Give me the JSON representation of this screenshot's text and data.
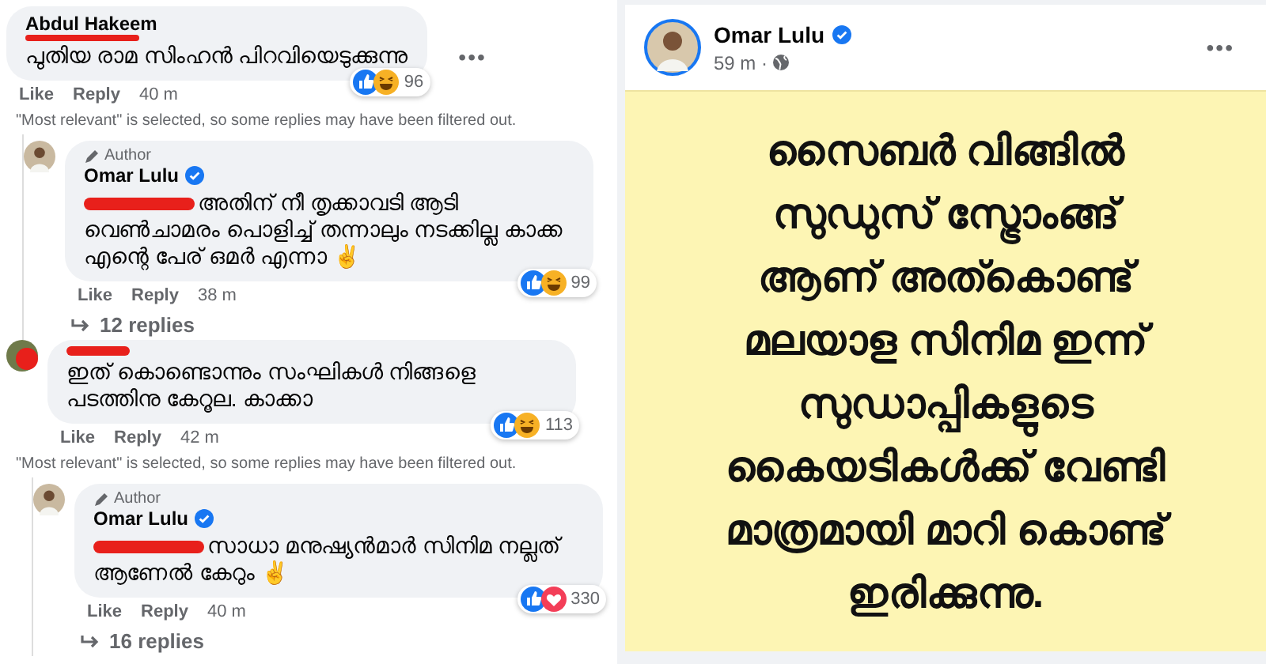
{
  "comments": [
    {
      "author": "Abdul Hakeem",
      "name_redacted": true,
      "text": "പുതിയ രാമ സിംഹൻ പിറവിയെടുക്കുന്നു",
      "reactions": [
        {
          "kind": "like"
        },
        {
          "kind": "haha"
        }
      ],
      "reaction_count": "96",
      "actions": [
        "Like",
        "Reply"
      ],
      "time": "40 m",
      "menu": "•••",
      "notice": "\"Most relevant\" is selected, so some replies may have been filtered out.",
      "replies": [
        {
          "badge": "Author",
          "author": "Omar Lulu",
          "verified": true,
          "mention_redacted": true,
          "text": "അതിന് നീ തൃക്കാവടി ആടി വെൺചാമരം പൊളിച്ച് തന്നാലും നടക്കില്ല കാക്ക എന്റെ പേര് ഒമർ എന്നാ ✌",
          "reactions": [
            {
              "kind": "like"
            },
            {
              "kind": "haha"
            }
          ],
          "reaction_count": "99",
          "actions": [
            "Like",
            "Reply"
          ],
          "time": "38 m",
          "more_replies": "12 replies"
        }
      ]
    },
    {
      "name_redacted": true,
      "text": "ഇത് കൊണ്ടൊന്നും സംഘികൾ നിങ്ങളെ പടത്തിനു കേറൂല. കാക്കാ",
      "reactions": [
        {
          "kind": "like"
        },
        {
          "kind": "haha"
        }
      ],
      "reaction_count": "113",
      "actions": [
        "Like",
        "Reply"
      ],
      "time": "42 m",
      "notice": "\"Most relevant\" is selected, so some replies may have been filtered out.",
      "replies": [
        {
          "badge": "Author",
          "author": "Omar Lulu",
          "verified": true,
          "mention_redacted": true,
          "text": "സാധാ മനുഷ്യൻമാർ സിനിമ നല്ലത് ആണേൽ കേറും ✌",
          "reactions": [
            {
              "kind": "like"
            },
            {
              "kind": "love"
            }
          ],
          "reaction_count": "330",
          "actions": [
            "Like",
            "Reply"
          ],
          "time": "40 m",
          "more_replies": "16 replies"
        }
      ]
    }
  ],
  "post": {
    "author": "Omar Lulu",
    "verified": true,
    "time": "59 m ·",
    "menu": "•••",
    "lines": [
      "സൈബർ വിങ്ങിൽ",
      "സുഡുസ് സ്ട്രോംങ്ങ്",
      "ആണ് അത്കൊണ്ട്",
      "മലയാള സിനിമ ഇന്ന്",
      "സുഡാപ്പികളുടെ",
      "കൈയടികൾക്ക് വേണ്ടി",
      "മാത്രമായി മാറി കൊണ്ട്",
      "ഇരിക്കുന്നു."
    ]
  }
}
